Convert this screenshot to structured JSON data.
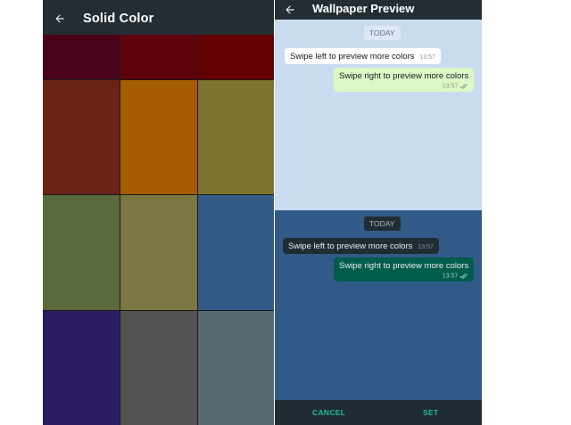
{
  "solid_color_screen": {
    "title": "Solid Color",
    "back_icon": "arrow-left-icon",
    "swatches": [
      {
        "color": "#4a0219"
      },
      {
        "color": "#5e020b"
      },
      {
        "color": "#640103"
      },
      {
        "color": "#6b2316"
      },
      {
        "color": "#a65c02"
      },
      {
        "color": "#7d7230"
      },
      {
        "color": "#5a6a3c"
      },
      {
        "color": "#7b7642"
      },
      {
        "color": "#345a88"
      },
      {
        "color": "#2c1c62"
      },
      {
        "color": "#525252"
      },
      {
        "color": "#56686f"
      }
    ]
  },
  "wallpaper_preview_screen": {
    "title": "Wallpaper Preview",
    "back_icon": "arrow-left-icon",
    "light_preview": {
      "background": "#c9dcef",
      "date_label": "TODAY",
      "incoming_text": "Swipe left to preview more colors",
      "incoming_time": "13:57",
      "outgoing_text": "Swipe right to preview more colors",
      "outgoing_time": "13:57",
      "read_receipt_icon": "double-check-icon"
    },
    "dark_preview": {
      "background": "#325a88",
      "date_label": "TODAY",
      "incoming_text": "Swipe left to preview more colors",
      "incoming_time": "13:57",
      "outgoing_text": "Swipe right to preview more colors",
      "outgoing_time": "13:57",
      "read_receipt_icon": "double-check-icon"
    },
    "actions": {
      "cancel_label": "CANCEL",
      "set_label": "SET"
    }
  },
  "colors": {
    "accent": "#27b9a0",
    "appbar": "#232d33",
    "light_bubble_in": "#ffffff",
    "light_bubble_out": "#dcf8c6",
    "dark_bubble_in": "#1f2c34",
    "dark_bubble_out": "#005c4b"
  }
}
